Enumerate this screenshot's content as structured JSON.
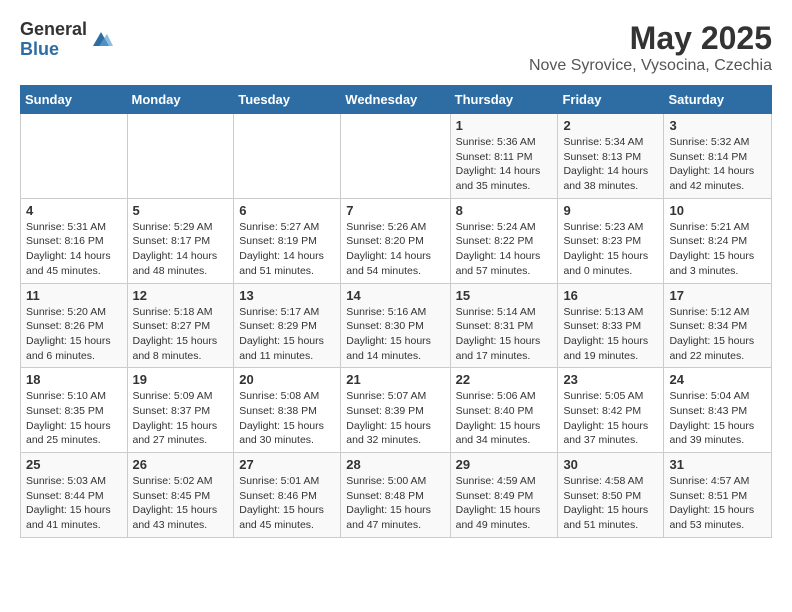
{
  "logo": {
    "general": "General",
    "blue": "Blue"
  },
  "title": "May 2025",
  "subtitle": "Nove Syrovice, Vysocina, Czechia",
  "headers": [
    "Sunday",
    "Monday",
    "Tuesday",
    "Wednesday",
    "Thursday",
    "Friday",
    "Saturday"
  ],
  "weeks": [
    [
      {
        "day": "",
        "info": ""
      },
      {
        "day": "",
        "info": ""
      },
      {
        "day": "",
        "info": ""
      },
      {
        "day": "",
        "info": ""
      },
      {
        "day": "1",
        "info": "Sunrise: 5:36 AM\nSunset: 8:11 PM\nDaylight: 14 hours\nand 35 minutes."
      },
      {
        "day": "2",
        "info": "Sunrise: 5:34 AM\nSunset: 8:13 PM\nDaylight: 14 hours\nand 38 minutes."
      },
      {
        "day": "3",
        "info": "Sunrise: 5:32 AM\nSunset: 8:14 PM\nDaylight: 14 hours\nand 42 minutes."
      }
    ],
    [
      {
        "day": "4",
        "info": "Sunrise: 5:31 AM\nSunset: 8:16 PM\nDaylight: 14 hours\nand 45 minutes."
      },
      {
        "day": "5",
        "info": "Sunrise: 5:29 AM\nSunset: 8:17 PM\nDaylight: 14 hours\nand 48 minutes."
      },
      {
        "day": "6",
        "info": "Sunrise: 5:27 AM\nSunset: 8:19 PM\nDaylight: 14 hours\nand 51 minutes."
      },
      {
        "day": "7",
        "info": "Sunrise: 5:26 AM\nSunset: 8:20 PM\nDaylight: 14 hours\nand 54 minutes."
      },
      {
        "day": "8",
        "info": "Sunrise: 5:24 AM\nSunset: 8:22 PM\nDaylight: 14 hours\nand 57 minutes."
      },
      {
        "day": "9",
        "info": "Sunrise: 5:23 AM\nSunset: 8:23 PM\nDaylight: 15 hours\nand 0 minutes."
      },
      {
        "day": "10",
        "info": "Sunrise: 5:21 AM\nSunset: 8:24 PM\nDaylight: 15 hours\nand 3 minutes."
      }
    ],
    [
      {
        "day": "11",
        "info": "Sunrise: 5:20 AM\nSunset: 8:26 PM\nDaylight: 15 hours\nand 6 minutes."
      },
      {
        "day": "12",
        "info": "Sunrise: 5:18 AM\nSunset: 8:27 PM\nDaylight: 15 hours\nand 8 minutes."
      },
      {
        "day": "13",
        "info": "Sunrise: 5:17 AM\nSunset: 8:29 PM\nDaylight: 15 hours\nand 11 minutes."
      },
      {
        "day": "14",
        "info": "Sunrise: 5:16 AM\nSunset: 8:30 PM\nDaylight: 15 hours\nand 14 minutes."
      },
      {
        "day": "15",
        "info": "Sunrise: 5:14 AM\nSunset: 8:31 PM\nDaylight: 15 hours\nand 17 minutes."
      },
      {
        "day": "16",
        "info": "Sunrise: 5:13 AM\nSunset: 8:33 PM\nDaylight: 15 hours\nand 19 minutes."
      },
      {
        "day": "17",
        "info": "Sunrise: 5:12 AM\nSunset: 8:34 PM\nDaylight: 15 hours\nand 22 minutes."
      }
    ],
    [
      {
        "day": "18",
        "info": "Sunrise: 5:10 AM\nSunset: 8:35 PM\nDaylight: 15 hours\nand 25 minutes."
      },
      {
        "day": "19",
        "info": "Sunrise: 5:09 AM\nSunset: 8:37 PM\nDaylight: 15 hours\nand 27 minutes."
      },
      {
        "day": "20",
        "info": "Sunrise: 5:08 AM\nSunset: 8:38 PM\nDaylight: 15 hours\nand 30 minutes."
      },
      {
        "day": "21",
        "info": "Sunrise: 5:07 AM\nSunset: 8:39 PM\nDaylight: 15 hours\nand 32 minutes."
      },
      {
        "day": "22",
        "info": "Sunrise: 5:06 AM\nSunset: 8:40 PM\nDaylight: 15 hours\nand 34 minutes."
      },
      {
        "day": "23",
        "info": "Sunrise: 5:05 AM\nSunset: 8:42 PM\nDaylight: 15 hours\nand 37 minutes."
      },
      {
        "day": "24",
        "info": "Sunrise: 5:04 AM\nSunset: 8:43 PM\nDaylight: 15 hours\nand 39 minutes."
      }
    ],
    [
      {
        "day": "25",
        "info": "Sunrise: 5:03 AM\nSunset: 8:44 PM\nDaylight: 15 hours\nand 41 minutes."
      },
      {
        "day": "26",
        "info": "Sunrise: 5:02 AM\nSunset: 8:45 PM\nDaylight: 15 hours\nand 43 minutes."
      },
      {
        "day": "27",
        "info": "Sunrise: 5:01 AM\nSunset: 8:46 PM\nDaylight: 15 hours\nand 45 minutes."
      },
      {
        "day": "28",
        "info": "Sunrise: 5:00 AM\nSunset: 8:48 PM\nDaylight: 15 hours\nand 47 minutes."
      },
      {
        "day": "29",
        "info": "Sunrise: 4:59 AM\nSunset: 8:49 PM\nDaylight: 15 hours\nand 49 minutes."
      },
      {
        "day": "30",
        "info": "Sunrise: 4:58 AM\nSunset: 8:50 PM\nDaylight: 15 hours\nand 51 minutes."
      },
      {
        "day": "31",
        "info": "Sunrise: 4:57 AM\nSunset: 8:51 PM\nDaylight: 15 hours\nand 53 minutes."
      }
    ]
  ]
}
